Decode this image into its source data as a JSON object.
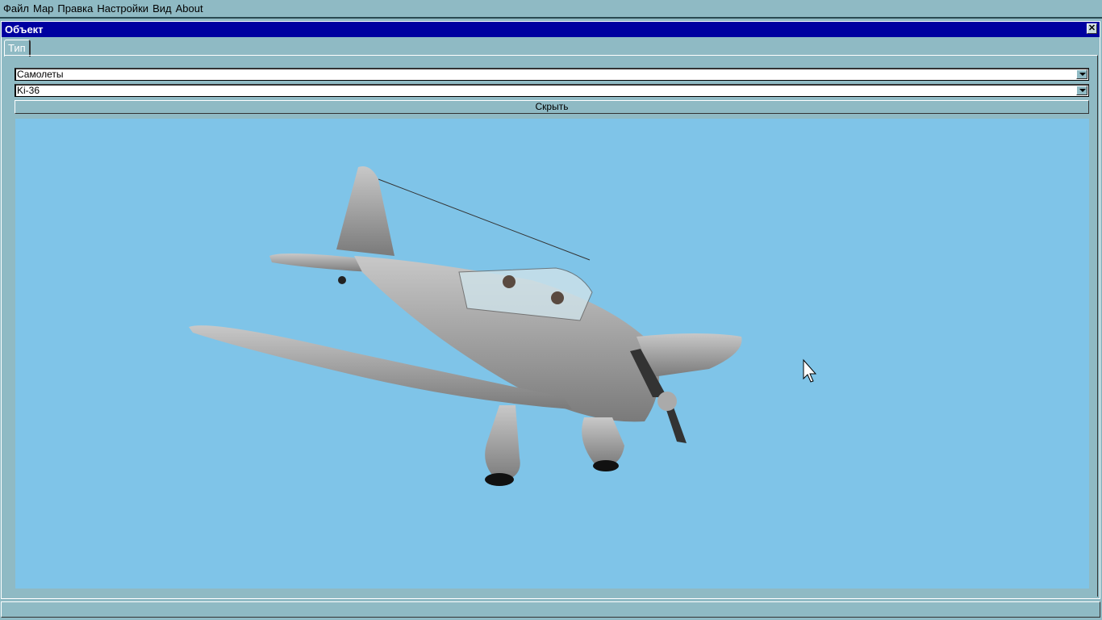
{
  "menu": [
    "Файл",
    "Мар",
    "Правка",
    "Настройки",
    "Вид",
    "About"
  ],
  "window": {
    "title": "Объект",
    "close_icon": "close-icon"
  },
  "tabs": [
    {
      "label": "Тип",
      "active": true
    }
  ],
  "category_select": {
    "value": "Самолеты"
  },
  "model_select": {
    "value": "Ki-36"
  },
  "hide_button": {
    "label": "Скрыть"
  },
  "colors": {
    "titlebar": "#0000a0",
    "background": "#8fbac4",
    "viewport": "#7fc4e8"
  }
}
